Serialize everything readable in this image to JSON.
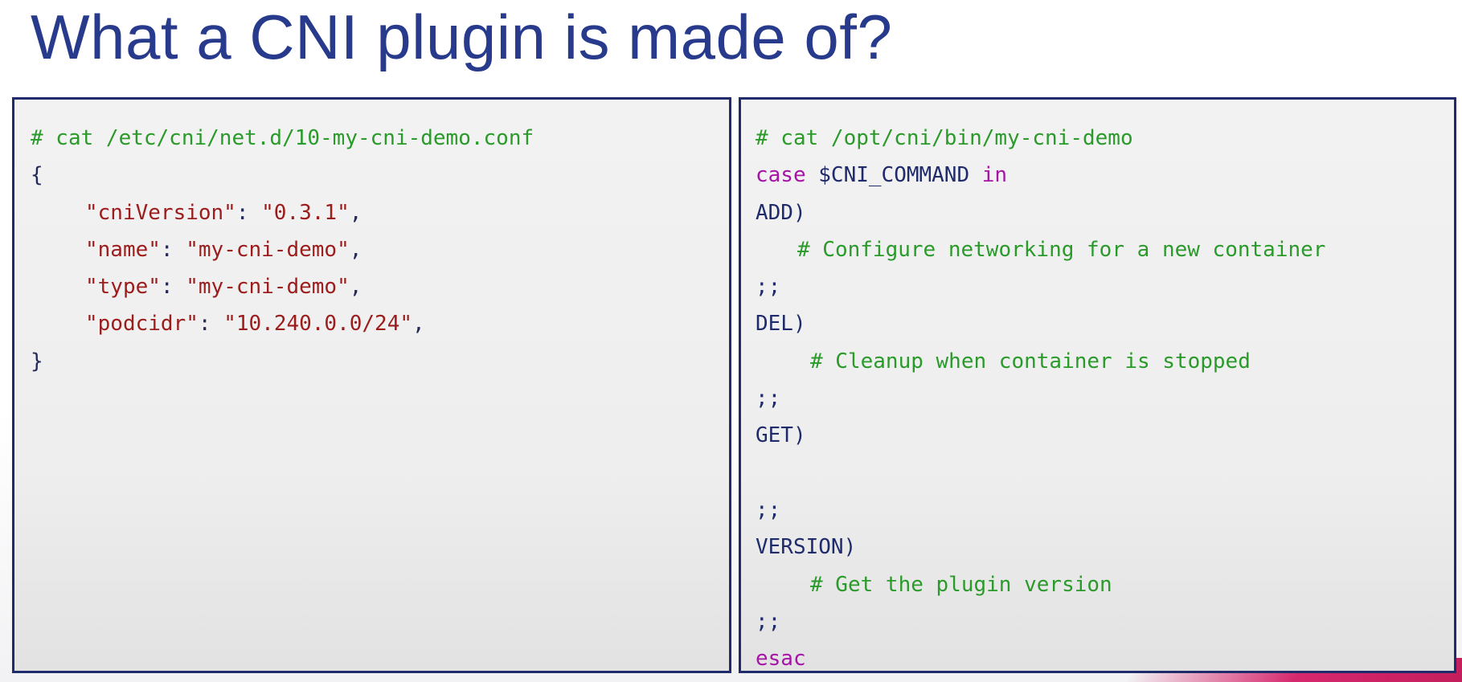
{
  "slide": {
    "title": "What a CNI plugin is made of?",
    "colors": {
      "title": "#283a8c",
      "border": "#1f2b6b",
      "comment": "#2a9a2a",
      "keyword": "#a614a6",
      "string": "#9c1c1c",
      "accent": "#d6286e"
    }
  },
  "left_panel": {
    "command": "# cat /etc/cni/net.d/10-my-cni-demo.conf",
    "open_brace": "{",
    "entries": [
      {
        "key": "\"cniVersion\"",
        "sep": ": ",
        "value": "\"0.3.1\"",
        "trail": ","
      },
      {
        "key": "\"name\"",
        "sep": ": ",
        "value": "\"my-cni-demo\"",
        "trail": ","
      },
      {
        "key": "\"type\"",
        "sep": ": ",
        "value": "\"my-cni-demo\"",
        "trail": ","
      },
      {
        "key": "\"podcidr\"",
        "sep": ": ",
        "value": "\"10.240.0.0/24\"",
        "trail": ","
      }
    ],
    "close_brace": "}"
  },
  "right_panel": {
    "command": "# cat /opt/cni/bin/my-cni-demo",
    "case_kw": "case",
    "case_var": " $CNI_COMMAND ",
    "in_kw": "in",
    "add_label": "ADD)",
    "add_comment": "# Configure networking for a new container",
    "sep1": ";;",
    "del_label": "DEL)",
    "del_comment": "# Cleanup when container is stopped",
    "sep2": ";;",
    "get_label": "GET)",
    "sep3": ";;",
    "version_label": "VERSION)",
    "version_comment": "# Get the plugin version",
    "sep4": ";;",
    "esac_kw": "esac"
  }
}
